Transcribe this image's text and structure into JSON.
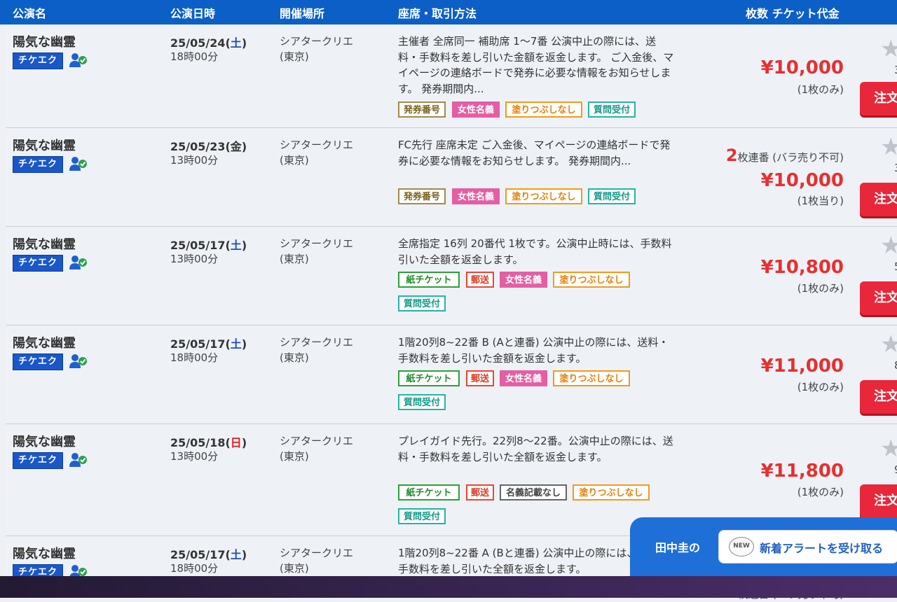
{
  "header": {
    "col_name": "公演名",
    "col_date": "公演日時",
    "col_venue": "開催場所",
    "col_seat": "座席・取引方法",
    "col_price": "枚数 チケット代金"
  },
  "badge_label": "チケエク",
  "order_label": "注文",
  "star_glyph": "★",
  "tag_labels": {
    "ticket_no": "発券番号",
    "female": "女性名義",
    "nuri": "塗りつぶしなし",
    "question": "質問受付",
    "paper": "紙チケット",
    "mail": "郵送",
    "noname": "名義記載なし"
  },
  "rows": [
    {
      "name": "陽気な幽霊",
      "date": "25/05/24(",
      "dow": "土",
      "date_close": ")",
      "time": "18時00分",
      "venue1": "シアタークリエ",
      "venue2": "(東京)",
      "desc": "主催者 全席同一 補助席 1〜7番 公演中止の際には、送料・手数料を差し引いた金額を返金します。 ご入金後、マイページの連絡ボードで発券に必要な情報をお知らせします。 発券期間内...",
      "price": "¥10,000",
      "qty": "(1枚のみ)",
      "rating": "3"
    },
    {
      "name": "陽気な幽霊",
      "date": "25/05/23(",
      "dow": "金",
      "date_close": ")",
      "time": "13時00分",
      "venue1": "シアタークリエ",
      "venue2": "(東京)",
      "desc": "FC先行 座席未定 ご入金後、マイページの連絡ボードで発券に必要な情報をお知らせします。 発券期間内...",
      "consec_num": "2",
      "consec_text": "枚連番 (バラ売り不可)",
      "price": "¥10,000",
      "qty": "(1枚当り)",
      "rating": "3"
    },
    {
      "name": "陽気な幽霊",
      "date": "25/05/17(",
      "dow": "土",
      "date_close": ")",
      "time": "13時00分",
      "venue1": "シアタークリエ",
      "venue2": "(東京)",
      "desc": "全席指定 16列 20番代 1枚です。公演中止時には、手数料引いた全額を返金します。",
      "price": "¥10,800",
      "qty": "(1枚のみ)",
      "rating": "5"
    },
    {
      "name": "陽気な幽霊",
      "date": "25/05/17(",
      "dow": "土",
      "date_close": ")",
      "time": "18時00分",
      "venue1": "シアタークリエ",
      "venue2": "(東京)",
      "desc": "1階20列8~22番 B (Aと連番) 公演中止の際には、送料・手数料を差し引いた金額を返金します。",
      "price": "¥11,000",
      "qty": "(1枚のみ)",
      "rating": "8"
    },
    {
      "name": "陽気な幽霊",
      "date": "25/05/18(",
      "dow": "日",
      "date_close": ")",
      "time": "13時00分",
      "venue1": "シアタークリエ",
      "venue2": "(東京)",
      "desc": "プレイガイド先行。22列8〜22番。公演中止の際には、送料・手数料を差し引いた全額を返金します。",
      "price": "¥11,800",
      "qty": "(1枚のみ)",
      "rating": "9"
    },
    {
      "name": "陽気な幽霊",
      "date": "25/05/17(",
      "dow": "土",
      "date_close": ")",
      "time": "18時00分",
      "venue1": "シアタークリエ",
      "venue2": "(東京)",
      "desc": "1階20列8~22番 A (Bと連番) 公演中止の際には、送料・手数料を差し引いた全額を返金します。",
      "consec_num": "2",
      "consec_text": "枚連番 (バラ売り不可)"
    }
  ],
  "alert": {
    "user": "田中圭の",
    "new_badge": "NEW",
    "button_label": "新着アラートを受け取る"
  },
  "colors": {
    "header_bg": "#0c5fc7",
    "price_red": "#e63030",
    "order_red": "#e8273a"
  }
}
